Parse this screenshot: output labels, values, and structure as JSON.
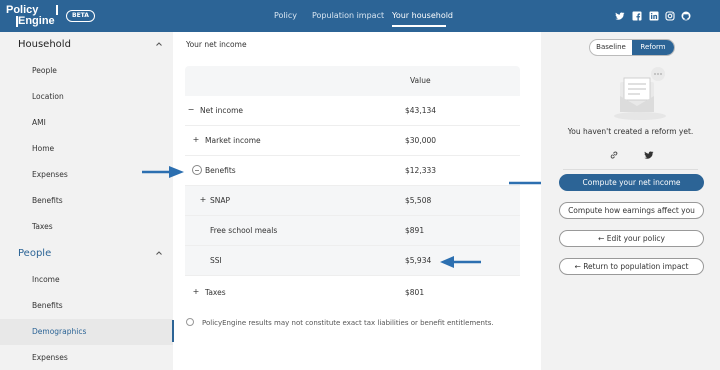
{
  "header": {
    "logo_line1": "Policy",
    "logo_line2": "Engine",
    "beta": "BETA",
    "nav": [
      "Policy",
      "Population impact",
      "Your household"
    ],
    "social_icons": [
      "twitter-icon",
      "facebook-icon",
      "linkedin-icon",
      "instagram-icon",
      "github-icon"
    ]
  },
  "sidebar": {
    "section1": {
      "title": "Household",
      "items": [
        "People",
        "Location",
        "AMI",
        "Home",
        "Expenses",
        "Benefits",
        "Taxes"
      ]
    },
    "section2": {
      "title": "People",
      "items": [
        "Income",
        "Benefits",
        "Demographics",
        "Expenses"
      ]
    },
    "selected": "Demographics"
  },
  "main": {
    "title": "Your net income",
    "column_header": "Value",
    "rows": [
      {
        "sign": "−",
        "label": "Net income",
        "value": "$43,134"
      },
      {
        "sign": "+",
        "label": "Market income",
        "value": "$30,000"
      },
      {
        "sign": "⊖",
        "label": "Benefits",
        "value": "$12,333"
      },
      {
        "sign": "+",
        "label": "SNAP",
        "value": "$5,508"
      },
      {
        "sign": "",
        "label": "Free school meals",
        "value": "$891"
      },
      {
        "sign": "",
        "label": "SSI",
        "value": "$5,934"
      },
      {
        "sign": "+",
        "label": "Taxes",
        "value": "$801"
      }
    ],
    "disclaimer": "PolicyEngine results may not constitute exact tax liabilities or benefit entitlements."
  },
  "right_panel": {
    "toggle": {
      "baseline": "Baseline",
      "reform": "Reform"
    },
    "no_reform_text": "You haven't created a reform yet.",
    "share_icons": [
      "link-icon",
      "twitter-icon"
    ],
    "buttons": {
      "compute_net_income": "Compute your net income",
      "compute_earnings": "Compute how earnings affect you",
      "edit_policy": "Edit your policy",
      "return_population": "Return to population impact"
    }
  },
  "colors": {
    "brand": "#2c6496",
    "arrow": "#2c6fb0",
    "sidebar_bg": "#f2f2f2"
  }
}
